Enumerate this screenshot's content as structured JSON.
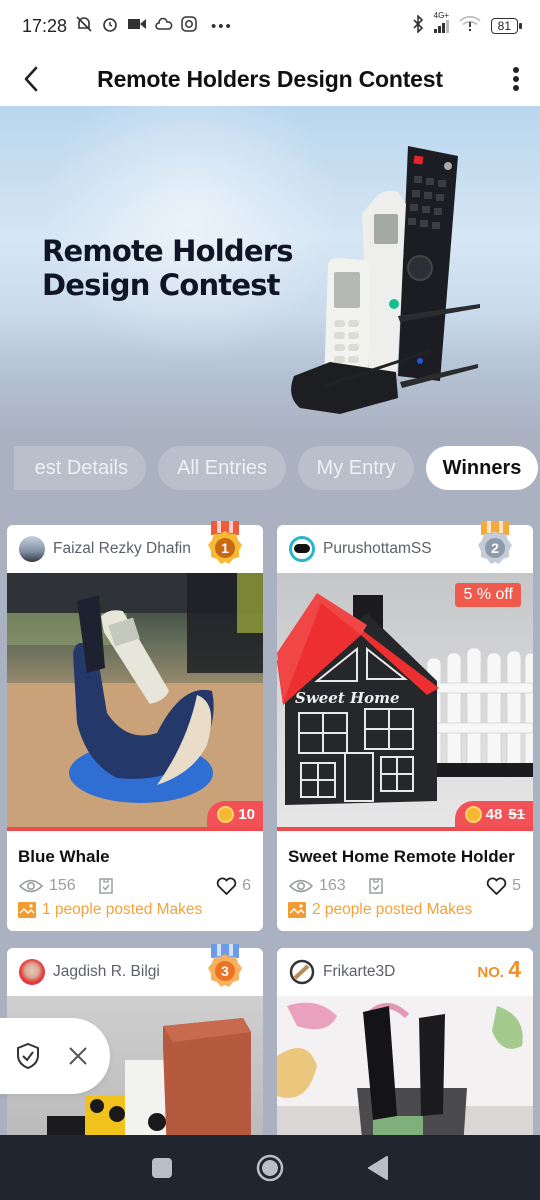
{
  "status_bar": {
    "time": "17:28",
    "left_icons": [
      "muted-bell-icon",
      "alarm-icon",
      "video-camera-icon",
      "cloud-icon",
      "instagram-icon",
      "more-notifications-icon"
    ],
    "network": "4G+",
    "battery": "81"
  },
  "app_bar": {
    "title": "Remote Holders Design Contest",
    "back_icon": "chevron-left-icon",
    "menu_icon": "more-vertical-icon"
  },
  "banner": {
    "line1": "Remote Holders",
    "line2": "Design Contest"
  },
  "tabs": [
    {
      "label": "est Details",
      "active": false
    },
    {
      "label": "All Entries",
      "active": false
    },
    {
      "label": "My Entry",
      "active": false
    },
    {
      "label": "Winners",
      "active": true
    }
  ],
  "entries": [
    {
      "author": "Faizal Rezky Dhafin",
      "rank": "1",
      "price": "10",
      "title": "Blue Whale",
      "views": "156",
      "likes": "6",
      "makes": "1 people posted Makes",
      "medal_color": "#f5b73a"
    },
    {
      "author": "PurushottamSS",
      "rank": "2",
      "discount": "5 % off",
      "price": "48",
      "original_price": "51",
      "title": "Sweet Home Remote Holder",
      "views": "163",
      "likes": "5",
      "makes": "2 people posted Makes",
      "medal_color": "#b8c4d2"
    },
    {
      "author": "Jagdish R. Bilgi",
      "rank": "3",
      "medal_color": "#f4a04a"
    },
    {
      "author": "Frikarte3D",
      "rank_prefix": "NO.",
      "rank": "4"
    }
  ],
  "floating_widget": {
    "icons": [
      "shield-check-icon",
      "close-icon"
    ]
  },
  "nav_bar": {
    "icons": [
      "recents-icon",
      "home-icon",
      "back-icon"
    ]
  }
}
